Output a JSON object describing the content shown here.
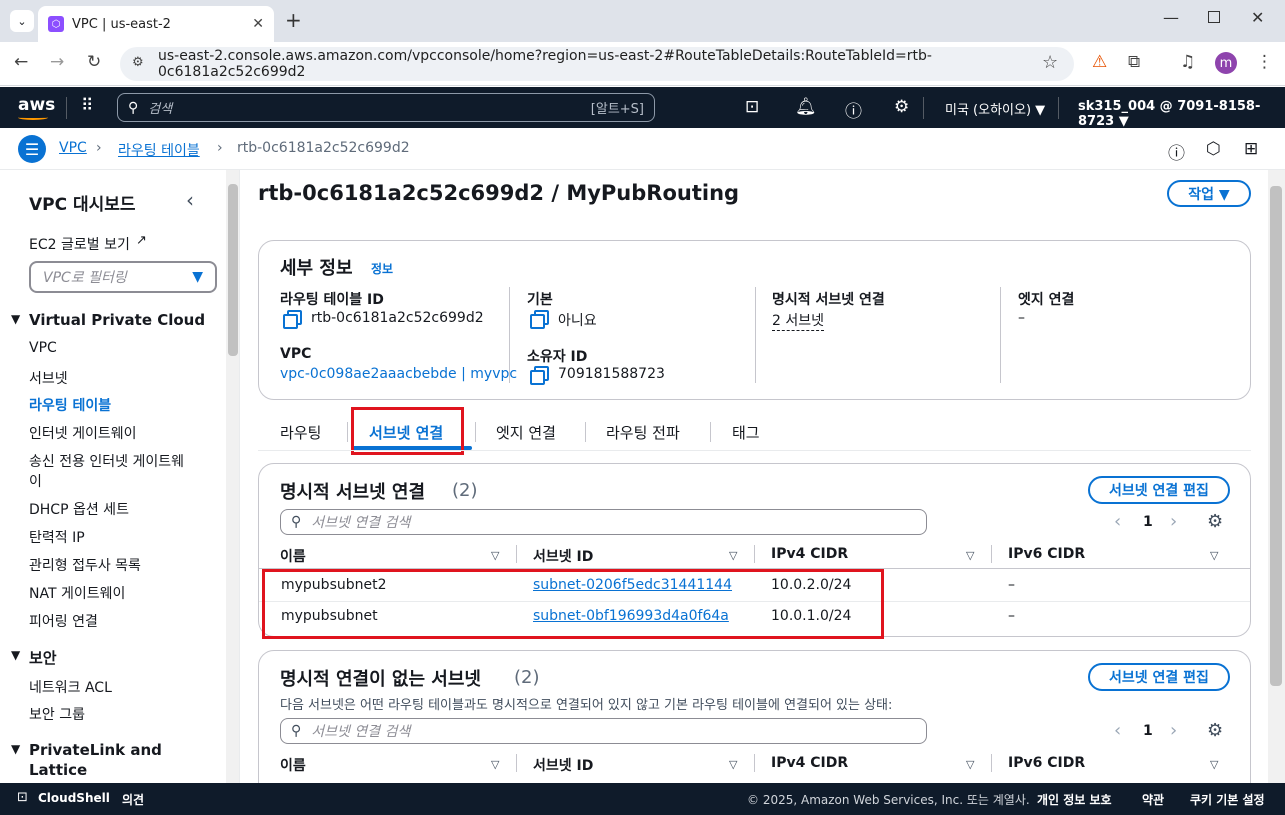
{
  "browser": {
    "tab_title": "VPC | us-east-2",
    "url": "us-east-2.console.aws.amazon.com/vpcconsole/home?region=us-east-2#RouteTableDetails:RouteTableId=rtb-0c6181a2c52c699d2",
    "profile_initial": "m"
  },
  "aws_header": {
    "logo": "aws",
    "search_placeholder": "검색",
    "search_shortcut": "[알트+S]",
    "region": "미국 (오하이오) ▼",
    "account": "sk315_004 @ 7091-8158-8723 ▼"
  },
  "breadcrumb": {
    "items": [
      "VPC",
      "라우팅 테이블",
      "rtb-0c6181a2c52c699d2"
    ]
  },
  "sidebar": {
    "title": "VPC 대시보드",
    "ec2_global": "EC2 글로벌 보기",
    "filter_placeholder": "VPC로 필터링",
    "section_vpc": "Virtual Private Cloud",
    "items": [
      "VPC",
      "서브넷",
      "라우팅 테이블",
      "인터넷 게이트웨이",
      "송신 전용 인터넷 게이트웨",
      "이",
      "DHCP 옵션 세트",
      "탄력적 IP",
      "관리형 접두사 목록",
      "NAT 게이트웨이",
      "피어링 연결"
    ],
    "section_security": "보안",
    "security_items": [
      "네트워크 ACL",
      "보안 그룹"
    ],
    "section_privatelink_1": "PrivateLink and",
    "section_privatelink_2": "Lattice"
  },
  "page": {
    "title": "rtb-0c6181a2c52c699d2 / MyPubRouting",
    "actions_button": "작업 ▼"
  },
  "details": {
    "heading": "세부 정보",
    "info": "정보",
    "rt_id_label": "라우팅 테이블 ID",
    "rt_id_value": "rtb-0c6181a2c52c699d2",
    "main_label": "기본",
    "main_value": "아니요",
    "explicit_label": "명시적 서브넷 연결",
    "explicit_value": "2 서브넷",
    "edge_label": "엣지 연결",
    "edge_value": "–",
    "vpc_label": "VPC",
    "vpc_value": "vpc-0c098ae2aaacbebde | myvpc",
    "owner_label": "소유자 ID",
    "owner_value": "709181588723"
  },
  "tabs": [
    "라우팅",
    "서브넷 연결",
    "엣지 연결",
    "라우팅 전파",
    "태그"
  ],
  "explicit_assoc": {
    "heading": "명시적 서브넷 연결",
    "count": "(2)",
    "edit_button": "서브넷 연결 편집",
    "search_placeholder": "서브넷 연결 검색",
    "page": "1",
    "columns": [
      "이름",
      "서브넷 ID",
      "IPv4 CIDR",
      "IPv6 CIDR"
    ],
    "rows": [
      {
        "name": "mypubsubnet2",
        "subnet_id": "subnet-0206f5edc31441144",
        "ipv4": "10.0.2.0/24",
        "ipv6": "–"
      },
      {
        "name": "mypubsubnet",
        "subnet_id": "subnet-0bf196993d4a0f64a",
        "ipv4": "10.0.1.0/24",
        "ipv6": "–"
      }
    ]
  },
  "non_explicit": {
    "heading": "명시적 연결이 없는 서브넷",
    "count": "(2)",
    "edit_button": "서브넷 연결 편집",
    "description": "다음 서브넷은 어떤 라우팅 테이블과도 명시적으로 연결되어 있지 않고 기본 라우팅 테이블에 연결되어 있는 상태:",
    "search_placeholder": "서브넷 연결 검색",
    "page": "1",
    "columns": [
      "이름",
      "서브넷 ID",
      "IPv4 CIDR",
      "IPv6 CIDR"
    ]
  },
  "footer": {
    "cloudshell": "CloudShell",
    "feedback": "의견",
    "copyright": "© 2025, Amazon Web Services, Inc. 또는 계열사.",
    "privacy": "개인 정보 보호",
    "terms": "약관",
    "cookies": "쿠키 기본 설정"
  },
  "colors": {
    "accent": "#0972d3",
    "header": "#0f1b2a",
    "highlight": "#e0141e"
  }
}
